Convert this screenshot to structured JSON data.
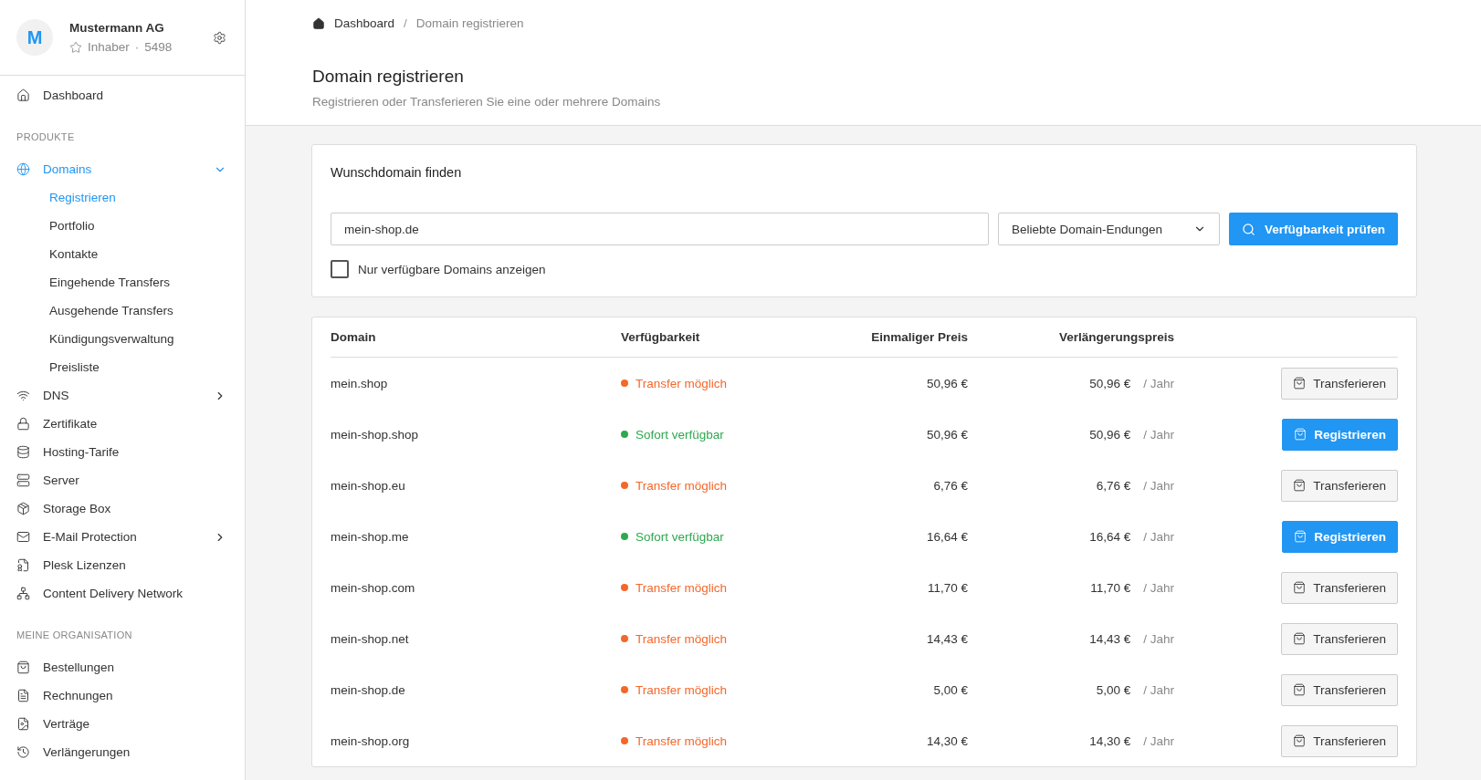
{
  "account": {
    "initial": "M",
    "name": "Mustermann AG",
    "role": "Inhaber",
    "separator": "·",
    "number": "5498"
  },
  "sidebar": {
    "top": [
      {
        "label": "Dashboard",
        "selected": false
      }
    ],
    "sections": [
      {
        "title": "PRODUKTE",
        "items": [
          {
            "label": "Domains",
            "kind": "group",
            "selected": true,
            "expanded": true,
            "children": [
              {
                "label": "Registrieren",
                "selected": true
              },
              {
                "label": "Portfolio",
                "selected": false
              },
              {
                "label": "Kontakte",
                "selected": false
              },
              {
                "label": "Eingehende Transfers",
                "selected": false
              },
              {
                "label": "Ausgehende Transfers",
                "selected": false
              },
              {
                "label": "Kündigungsverwaltung",
                "selected": false
              },
              {
                "label": "Preisliste",
                "selected": false
              }
            ]
          },
          {
            "label": "DNS",
            "kind": "group",
            "selected": false,
            "expanded": false
          },
          {
            "label": "Zertifikate",
            "kind": "link",
            "selected": false
          },
          {
            "label": "Hosting-Tarife",
            "kind": "link",
            "selected": false
          },
          {
            "label": "Server",
            "kind": "link",
            "selected": false
          },
          {
            "label": "Storage Box",
            "kind": "link",
            "selected": false
          },
          {
            "label": "E-Mail Protection",
            "kind": "group",
            "selected": false,
            "expanded": false
          },
          {
            "label": "Plesk Lizenzen",
            "kind": "link",
            "selected": false
          },
          {
            "label": "Content Delivery Network",
            "kind": "link",
            "selected": false
          }
        ]
      },
      {
        "title": "MEINE ORGANISATION",
        "items": [
          {
            "label": "Bestellungen",
            "kind": "link",
            "selected": false
          },
          {
            "label": "Rechnungen",
            "kind": "link",
            "selected": false
          },
          {
            "label": "Verträge",
            "kind": "link",
            "selected": false
          },
          {
            "label": "Verlängerungen",
            "kind": "link",
            "selected": false
          }
        ]
      }
    ]
  },
  "breadcrumb": {
    "separator": "/",
    "items": [
      "Dashboard",
      "Domain registrieren"
    ]
  },
  "page": {
    "title": "Domain registrieren",
    "subtitle": "Registrieren oder Transferieren Sie eine oder mehrere Domains"
  },
  "search": {
    "title": "Wunschdomain finden",
    "value": "mein-shop.de",
    "select": "Beliebte Domain-Endungen",
    "button": "Verfügbarkeit prüfen",
    "filter_label": "Nur verfügbare Domains anzeigen",
    "filter_checked": false
  },
  "table": {
    "columns": [
      "Domain",
      "Verfügbarkeit",
      "Einmaliger Preis",
      "Verlängerungspreis"
    ],
    "rows": [
      {
        "domain": "mein.shop",
        "kind": "transfer",
        "availability": "Transfer möglich",
        "price": "50,96 €",
        "renewal": "50,96 €",
        "period": "/ Jahr",
        "action": "Transferieren"
      },
      {
        "domain": "mein-shop.shop",
        "kind": "register",
        "availability": "Sofort verfügbar",
        "price": "50,96 €",
        "renewal": "50,96 €",
        "period": "/ Jahr",
        "action": "Registrieren"
      },
      {
        "domain": "mein-shop.eu",
        "kind": "transfer",
        "availability": "Transfer möglich",
        "price": "6,76 €",
        "renewal": "6,76 €",
        "period": "/ Jahr",
        "action": "Transferieren"
      },
      {
        "domain": "mein-shop.me",
        "kind": "register",
        "availability": "Sofort verfügbar",
        "price": "16,64 €",
        "renewal": "16,64 €",
        "period": "/ Jahr",
        "action": "Registrieren"
      },
      {
        "domain": "mein-shop.com",
        "kind": "transfer",
        "availability": "Transfer möglich",
        "price": "11,70 €",
        "renewal": "11,70 €",
        "period": "/ Jahr",
        "action": "Transferieren"
      },
      {
        "domain": "mein-shop.net",
        "kind": "transfer",
        "availability": "Transfer möglich",
        "price": "14,43 €",
        "renewal": "14,43 €",
        "period": "/ Jahr",
        "action": "Transferieren"
      },
      {
        "domain": "mein-shop.de",
        "kind": "transfer",
        "availability": "Transfer möglich",
        "price": "5,00 €",
        "renewal": "5,00 €",
        "period": "/ Jahr",
        "action": "Transferieren"
      },
      {
        "domain": "mein-shop.org",
        "kind": "transfer",
        "availability": "Transfer möglich",
        "price": "14,30 €",
        "renewal": "14,30 €",
        "period": "/ Jahr",
        "action": "Transferieren"
      }
    ]
  }
}
